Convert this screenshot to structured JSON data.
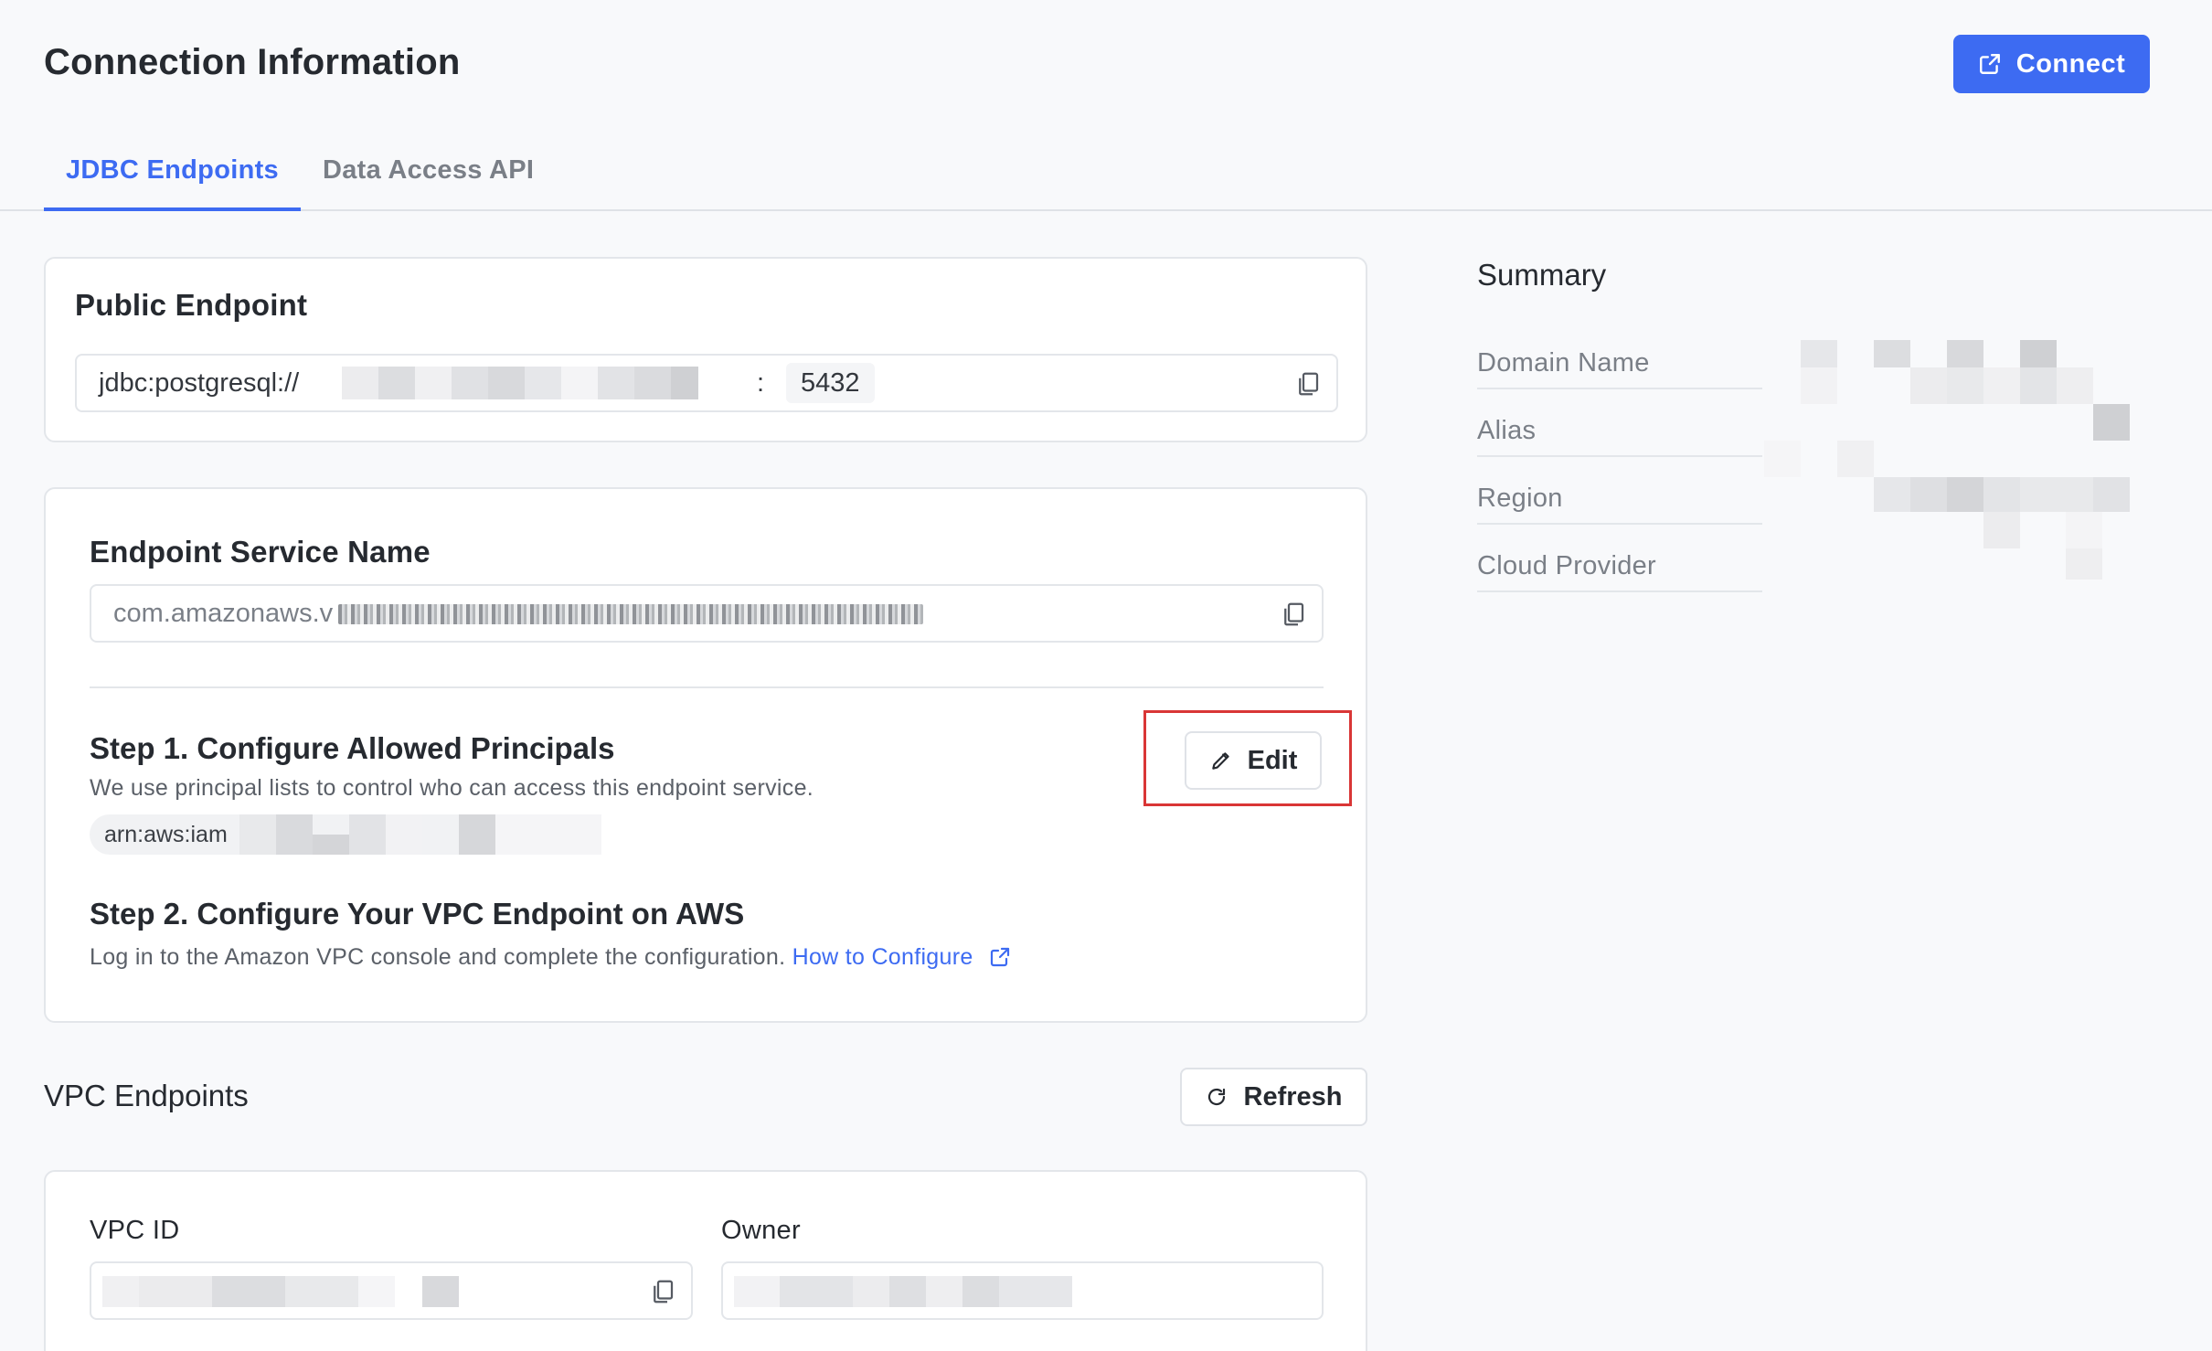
{
  "header": {
    "title": "Connection Information",
    "connect_label": "Connect"
  },
  "tabs": [
    {
      "label": "JDBC Endpoints",
      "active": true
    },
    {
      "label": "Data Access API",
      "active": false
    }
  ],
  "public_endpoint": {
    "title": "Public Endpoint",
    "prefix": "jdbc:postgresql://",
    "separator": ":",
    "port": "5432"
  },
  "endpoint_service": {
    "title": "Endpoint Service Name",
    "value_prefix": "com.amazonaws.v"
  },
  "step1": {
    "title": "Step 1. Configure Allowed Principals",
    "description": "We use principal lists to control who can access this endpoint service.",
    "arn_prefix": "arn:aws:iam",
    "edit_label": "Edit"
  },
  "step2": {
    "title": "Step 2. Configure Your VPC Endpoint on AWS",
    "description": "Log in to the Amazon VPC console and complete the configuration.",
    "link_label": "How to Configure"
  },
  "vpc_endpoints": {
    "title": "VPC Endpoints",
    "refresh_label": "Refresh",
    "vpc_id_label": "VPC ID",
    "owner_label": "Owner"
  },
  "summary": {
    "title": "Summary",
    "rows": [
      {
        "label": "Domain Name"
      },
      {
        "label": "Alias"
      },
      {
        "label": "Region"
      },
      {
        "label": "Cloud Provider"
      }
    ]
  },
  "colors": {
    "accent": "#3d6bf2",
    "highlight": "#d93636"
  }
}
